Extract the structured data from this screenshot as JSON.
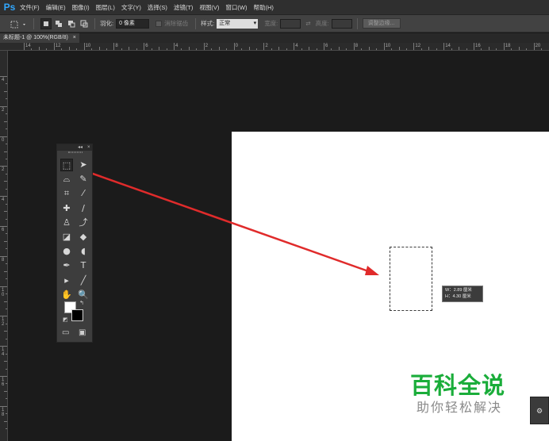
{
  "app": {
    "logo": "Ps",
    "menus": [
      "文件(F)",
      "编辑(E)",
      "图像(I)",
      "图层(L)",
      "文字(Y)",
      "选择(S)",
      "滤镜(T)",
      "视图(V)",
      "窗口(W)",
      "帮助(H)"
    ]
  },
  "options_bar": {
    "feather_label": "羽化:",
    "feather_value": "0 像素",
    "antialias_label": "消除锯齿",
    "style_label": "样式:",
    "style_value": "正常",
    "width_label": "宽度:",
    "height_label": "高度:",
    "refine_edge_button": "调整边缘..."
  },
  "document_tab": {
    "title": "未标题-1 @ 100%(RGB/8)",
    "close": "×"
  },
  "ruler_top": {
    "labels": [
      "14",
      "12",
      "10",
      "8",
      "6",
      "4",
      "2",
      "0",
      "2",
      "4",
      "6",
      "8",
      "10",
      "12",
      "14",
      "16",
      "18",
      "20"
    ]
  },
  "ruler_left": {
    "labels": [
      "4",
      "2",
      "0",
      "2",
      "4",
      "6",
      "8",
      "1 0",
      "1 2",
      "1 4",
      "1 6",
      "1 8"
    ]
  },
  "toolbox": {
    "header_icons": [
      "collapse-icon",
      "close-icon"
    ],
    "collapse_glyph": "◂◂",
    "close_glyph": "×",
    "tools": [
      {
        "name": "rectangular-marquee-tool-icon",
        "glyph": "⬚",
        "active": true
      },
      {
        "name": "move-tool-icon",
        "glyph": "➤"
      },
      {
        "name": "lasso-tool-icon",
        "glyph": "⌓"
      },
      {
        "name": "quick-selection-tool-icon",
        "glyph": "✎"
      },
      {
        "name": "crop-tool-icon",
        "glyph": "⌗"
      },
      {
        "name": "eyedropper-tool-icon",
        "glyph": "⁄"
      },
      {
        "name": "spot-healing-brush-icon",
        "glyph": "✚"
      },
      {
        "name": "brush-tool-icon",
        "glyph": "∕"
      },
      {
        "name": "clone-stamp-tool-icon",
        "glyph": "♙"
      },
      {
        "name": "history-brush-icon",
        "glyph": "⤴"
      },
      {
        "name": "eraser-tool-icon",
        "glyph": "◪"
      },
      {
        "name": "paint-bucket-tool-icon",
        "glyph": "◆"
      },
      {
        "name": "blur-tool-icon",
        "glyph": "●"
      },
      {
        "name": "dodge-tool-icon",
        "glyph": "◖"
      },
      {
        "name": "pen-tool-icon",
        "glyph": "✒"
      },
      {
        "name": "type-tool-icon",
        "glyph": "T"
      },
      {
        "name": "path-selection-tool-icon",
        "glyph": "▸"
      },
      {
        "name": "line-tool-icon",
        "glyph": "╱"
      },
      {
        "name": "hand-tool-icon",
        "glyph": "✋"
      },
      {
        "name": "zoom-tool-icon",
        "glyph": "🔍"
      }
    ],
    "fg_color": "#ffffff",
    "bg_color": "#000000",
    "quick_mask_glyph": "▭",
    "screen_mode_glyph": "▣"
  },
  "selection_tooltip": {
    "w_line": "W：2.89 厘米",
    "h_line": "H：4.30 厘米"
  },
  "annotation": {
    "arrow_color": "#e02b2b"
  },
  "watermark": {
    "title": "百科全说",
    "subtitle": "助你轻松解决"
  },
  "side_widget": {
    "glyph": "⚙"
  }
}
